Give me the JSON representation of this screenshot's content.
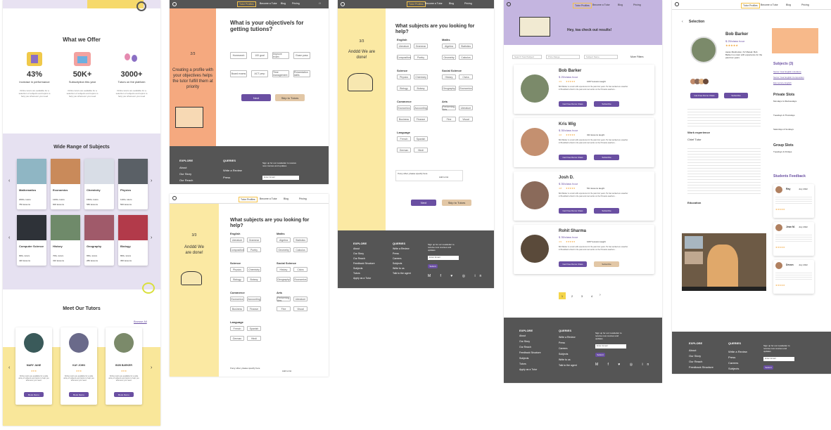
{
  "home": {
    "offer_title": "What we Offer",
    "stats": [
      {
        "value": "43%",
        "label": "Increase in performance",
        "desc": "Online tutors are available for a selection of subjects and topics to help you whenever you need"
      },
      {
        "value": "50K+",
        "label": "Subscription this year",
        "desc": "Online tutors are available for a selection of subjects and topics to help you whenever you need"
      },
      {
        "value": "3000+",
        "label": "Tutors on the platform",
        "desc": "Online tutors are available for a selection of subjects and topics to help you whenever you need"
      }
    ],
    "subjects_title": "Wide Range of Subjects",
    "subjects": [
      {
        "name": "Mathematics",
        "tutors": "2000+ tutors",
        "lessons": "750 lessons",
        "color": "#8fb6c4"
      },
      {
        "name": "Economics",
        "tutors": "1200+ tutors",
        "lessons": "600 lessons",
        "color": "#c98a5a"
      },
      {
        "name": "Chemistry",
        "tutors": "1500+ tutors",
        "lessons": "580 lessons",
        "color": "#d8dde6"
      },
      {
        "name": "Physics",
        "tutors": "1100+ tutors",
        "lessons": "500 lessons",
        "color": "#5a6066"
      },
      {
        "name": "Computer Science",
        "tutors": "900+ tutors",
        "lessons": "420 lessons",
        "color": "#2e3238"
      },
      {
        "name": "History",
        "tutors": "700+ tutors",
        "lessons": "310 lessons",
        "color": "#6f8a6a"
      },
      {
        "name": "Geography",
        "tutors": "650+ tutors",
        "lessons": "280 lessons",
        "color": "#a05a6a"
      },
      {
        "name": "Biology",
        "tutors": "800+ tutors",
        "lessons": "360 lessons",
        "color": "#b23a4a"
      }
    ],
    "tutors_title": "Meet Our Tutors",
    "browse_all": "Browse All",
    "tutors": [
      {
        "name": "MARY JANE",
        "desc": "Online tutors are available for a wide array of subjects and topics to help you whenever you need.",
        "btn": "Book Demo"
      },
      {
        "name": "KAY JOHN",
        "desc": "Online tutors are available for a wide array of subjects and topics to help you whenever you need.",
        "btn": "Book Demo"
      },
      {
        "name": "BOB BARKER",
        "desc": "Online tutors are available for a wide array of subjects and topics to help you whenever you need.",
        "btn": "Book Demo"
      }
    ]
  },
  "nav": {
    "items": [
      "Tutor Profiles",
      "Become a Tutor",
      "Blog",
      "Pricing"
    ]
  },
  "objective": {
    "step": "2/3",
    "left_text": "Creating a profile with your objectives helps the tutor fulfill them at priority",
    "title": "What is your objective/s for getting tutions?",
    "options": [
      "Homework",
      "100 goal",
      "Improve exam",
      "Exam pass",
      "Board exams",
      "ACT prep",
      "Time management",
      "Presentation skills"
    ],
    "next": "Next",
    "skip": "Skip to Tutors"
  },
  "subjects_step": {
    "step": "3/3",
    "left_text": "Anddd We are done!",
    "title": "What subjects are you looking for help?",
    "groups": [
      {
        "name": "English",
        "items": [
          "Literature",
          "Grammar",
          "Composition",
          "Poetry"
        ]
      },
      {
        "name": "Maths",
        "items": [
          "Algebra",
          "Statistics",
          "Geometry",
          "Calculus"
        ]
      },
      {
        "name": "Science",
        "items": [
          "Physics",
          "Chemistry",
          "Biology",
          "Botany"
        ]
      },
      {
        "name": "Social Science",
        "items": [
          "History",
          "Civics",
          "Geography",
          "Economics"
        ]
      },
      {
        "name": "Commerce",
        "items": [
          "Economics",
          "Accounting",
          "Business",
          "Finance"
        ]
      },
      {
        "name": "Arts",
        "items": [
          "Performing Arts",
          "Literature",
          "Fine",
          "Visual"
        ]
      },
      {
        "name": "Language",
        "items": [
          "French",
          "Spanish",
          "German",
          "Hindi"
        ]
      }
    ],
    "other": "If any other, please specify here",
    "add": "Add to list",
    "next": "Next",
    "skip": "Skip to Tutors"
  },
  "footer": {
    "explore": "EXPLORE",
    "explore_items": [
      "About",
      "Our Story",
      "Our Reach",
      "Feedback Structure",
      "Subjects",
      "Tutors",
      "Apply as a Tutor"
    ],
    "queries": "QUERIES",
    "query_items": [
      "Write a Review",
      "Press",
      "Careers",
      "Subjects",
      "Write to us",
      "Talk to the agent"
    ],
    "newsletter": "Sign up for our newsletter to receive new courses and updates",
    "email_placeholder": "Enter Email",
    "submit": "Submit"
  },
  "results": {
    "banner": "Hey, toa check out results!",
    "search_placeholder": "Search Tutor/Subject",
    "filter1": "Price Range",
    "filter2": "Subject Name",
    "more_filters": "More Filters",
    "tutors": [
      {
        "name": "Bob Barker",
        "price": "$ 25/class hour",
        "rating": "4.9",
        "lessons": "1067 lessons taught",
        "desc": "Bob Barker is a tutor with experience for the past four years. He has worked as a teacher in Brookfield school in the past and now works on the Pinnacle teachers...",
        "demo": "Get Free Demo Class",
        "sub": "Subscribe"
      },
      {
        "name": "Kris Wig",
        "price": "$ 35/class hour",
        "rating": "4.6",
        "lessons": "324 lessons taught",
        "desc": "Bob Barker is a tutor with experience for the past four years. He has worked as a teacher in Brookfield school in the past and now works on the Pinnacle teachers...",
        "demo": "Get Free Demo Class",
        "sub": "Subscribe"
      },
      {
        "name": "Josh D.",
        "price": "$ 35/class hour",
        "rating": "4.8",
        "lessons": "531 lessons taught",
        "desc": "Bob Barker is a tutor with experience for the past four years. He has worked as a teacher in Brookfield school in the past and now works on the Pinnacle teachers...",
        "demo": "Get Free Demo Class",
        "sub": "Subscribe"
      },
      {
        "name": "Rohit Sharma",
        "price": "$ 35/class hour",
        "rating": "4.9",
        "lessons": "1067 lessons taught",
        "desc": "Bob Barker is a tutor with experience for the past four years. He has worked as a teacher in Brookfield school in the past and now works on the Pinnacle teachers...",
        "demo": "Get Free Demo Class",
        "sub": "Subscribe"
      }
    ],
    "pages": [
      "1",
      "2",
      "3",
      "4"
    ]
  },
  "profile": {
    "back": "Selection",
    "name": "Bob Barker",
    "price": "$ 25/class hour",
    "about": "Aarav Manhotran, KV Manali. Bob Barker is a tutor with experience for the past four years.",
    "demo": "Get Free Demo Class",
    "sub": "Subscribe",
    "subjects_title": "Subjects (3)",
    "subject_links": [
      "Senior Year English Literature",
      "Senior Year English Composition",
      "Elementary English"
    ],
    "private_title": "Private Slots",
    "private_days": [
      "Mondays & Wednesdays",
      "Tuesdays & Thursdays",
      "Saturdays & Sundays"
    ],
    "group_title": "Group Slots",
    "group_days": [
      "Tuesdays & Fridays"
    ],
    "work_title": "Work experience",
    "work_role": "Chief Tutor",
    "edu_title": "Education",
    "feedback_title": "Students Feedback",
    "feedback": [
      {
        "name": "Ray",
        "date": "July 2022"
      },
      {
        "name": "Jean M.",
        "date": "July 2022"
      },
      {
        "name": "Devon",
        "date": "July 2022"
      }
    ]
  }
}
